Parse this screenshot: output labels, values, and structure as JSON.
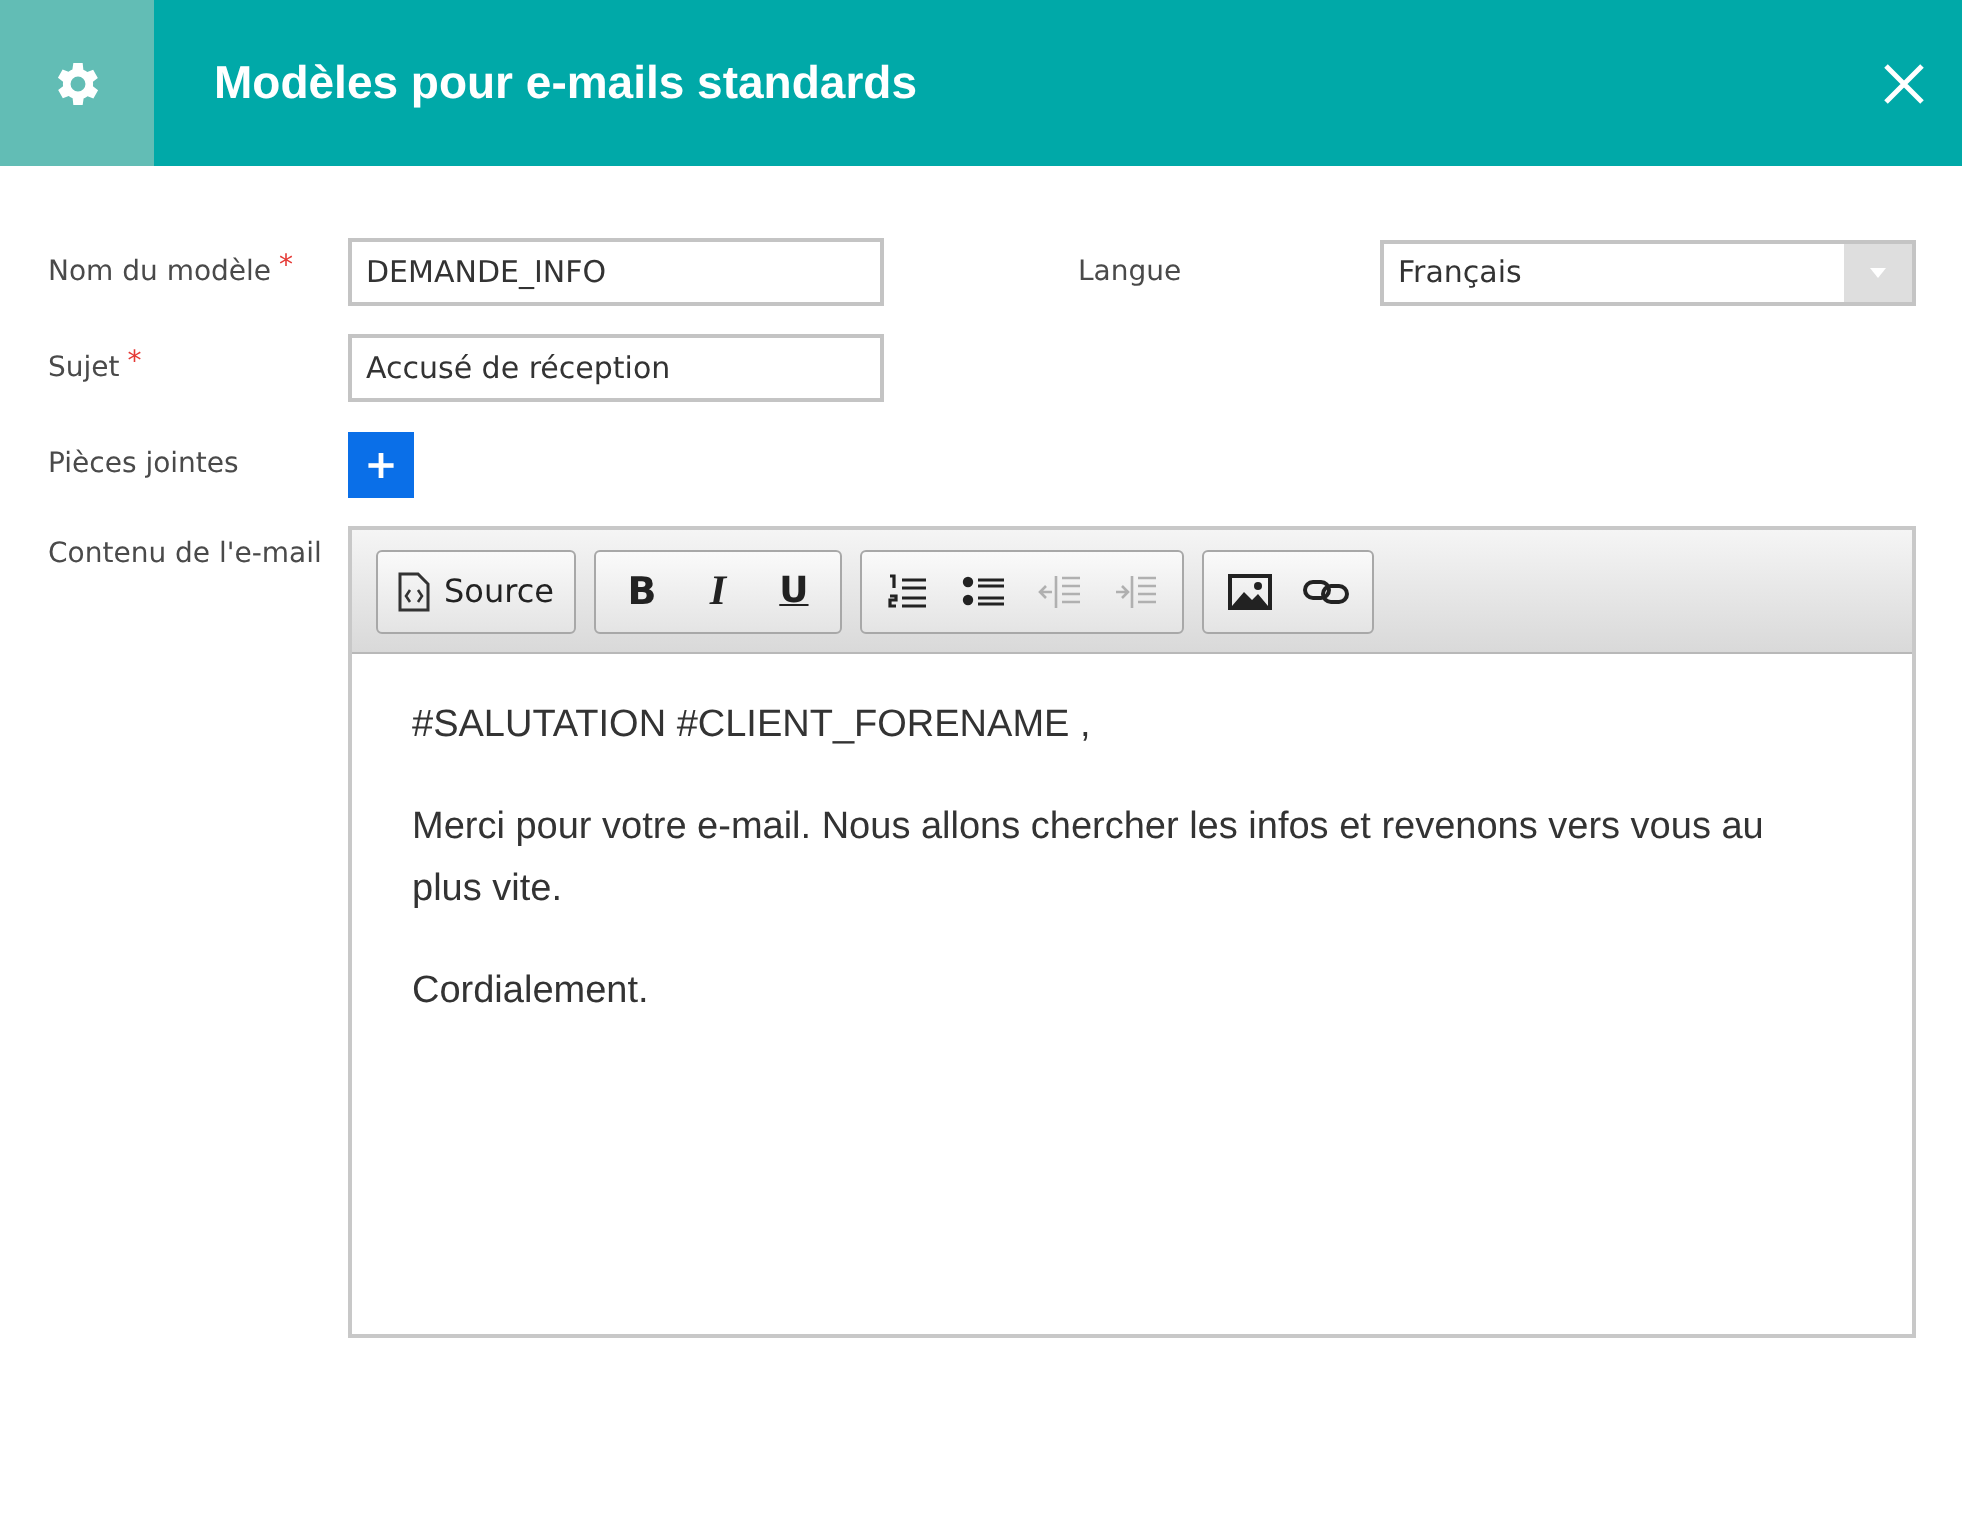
{
  "header": {
    "title": "Modèles pour e-mails standards"
  },
  "fields": [
    {
      "kind": "text",
      "label": "Nom du modèle",
      "marker": "*",
      "value": "DEMANDE_INFO"
    },
    {
      "kind": "text",
      "label": "Sujet",
      "marker": "*",
      "value": "Accusé de réception"
    },
    {
      "kind": "attach",
      "label": "Pièces jointes",
      "button": "+"
    }
  ],
  "language": {
    "label": "Langue",
    "value": "Français"
  },
  "editor": {
    "label": "Contenu de l'e-mail",
    "toolbar": [
      [
        {
          "kind": "source",
          "label": "Source",
          "disabled": false
        }
      ],
      [
        {
          "kind": "bold",
          "label": "B",
          "disabled": false
        },
        {
          "kind": "italic",
          "label": "I",
          "disabled": false
        },
        {
          "kind": "underline",
          "label": "U",
          "disabled": false
        }
      ],
      [
        {
          "kind": "numbered-list",
          "disabled": false
        },
        {
          "kind": "bullet-list",
          "disabled": false
        },
        {
          "kind": "outdent",
          "disabled": true
        },
        {
          "kind": "indent",
          "disabled": true
        }
      ],
      [
        {
          "kind": "image",
          "disabled": false
        },
        {
          "kind": "link",
          "disabled": false
        }
      ]
    ],
    "paragraphs": [
      "#SALUTATION #CLIENT_FORENAME ,",
      "Merci pour votre e-mail. Nous allons chercher les infos et revenons vers vous au plus vite.",
      "Cordialement."
    ]
  }
}
